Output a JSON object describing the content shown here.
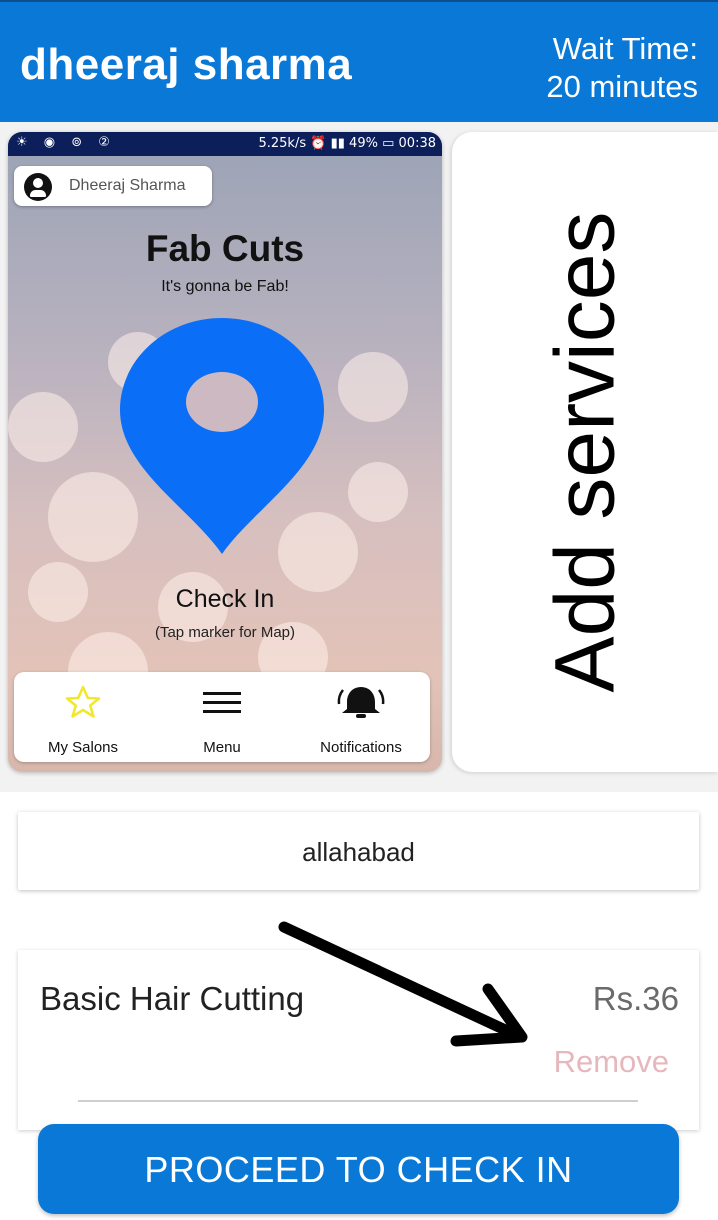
{
  "header": {
    "user_name": "dheeraj sharma",
    "wait_label": "Wait Time:",
    "wait_value": "20 minutes"
  },
  "phone_screenshot": {
    "status_bar": {
      "speed": "5.25k/s",
      "battery": "49%",
      "time": "00:38"
    },
    "user_chip": {
      "name": "Dheeraj Sharma"
    },
    "salon": {
      "title": "Fab Cuts",
      "tagline": "It's gonna be Fab!"
    },
    "check_in": {
      "label": "Check In",
      "hint": "(Tap marker for Map)"
    },
    "bottom_nav": {
      "items": [
        {
          "label": "My Salons",
          "icon": "star-icon"
        },
        {
          "label": "Menu",
          "icon": "menu-icon"
        },
        {
          "label": "Notifications",
          "icon": "bell-icon"
        }
      ]
    }
  },
  "add_services": {
    "label": "Add services"
  },
  "location": {
    "value": "allahabad"
  },
  "service_item": {
    "name": "Basic Hair Cutting",
    "price": "Rs.36",
    "remove_label": "Remove"
  },
  "actions": {
    "proceed_label": "PROCEED TO CHECK IN"
  },
  "colors": {
    "primary": "#0a78d6",
    "marker": "#0a6ef7",
    "remove": "#e6b8bd",
    "star": "#f2e82a"
  }
}
